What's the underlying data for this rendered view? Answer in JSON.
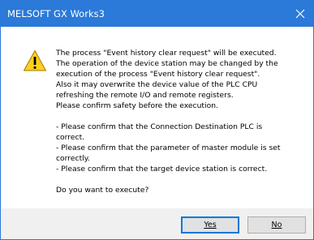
{
  "window": {
    "title": "MELSOFT GX Works3",
    "close_icon": "close-icon"
  },
  "dialog": {
    "icon": "warning-icon",
    "message": "The process \"Event history clear request\" will be executed.\nThe operation of the device station may be changed by the\nexecution of the process \"Event history clear request\".\nAlso it may overwrite the device value of the PLC CPU\nrefreshing the remote I/O and remote registers.\nPlease confirm safety before the execution.\n\n- Please confirm that the Connection Destination PLC is\ncorrect.\n- Please confirm that the parameter of master module is set\ncorrectly.\n- Please confirm that the target device station is correct.\n\nDo you want to execute?"
  },
  "buttons": {
    "yes_label": "Yes",
    "no_label": "No"
  },
  "colors": {
    "titlebar": "#2b79d8",
    "footer": "#f0f0f0",
    "warning_fill": "#fcd21a"
  }
}
